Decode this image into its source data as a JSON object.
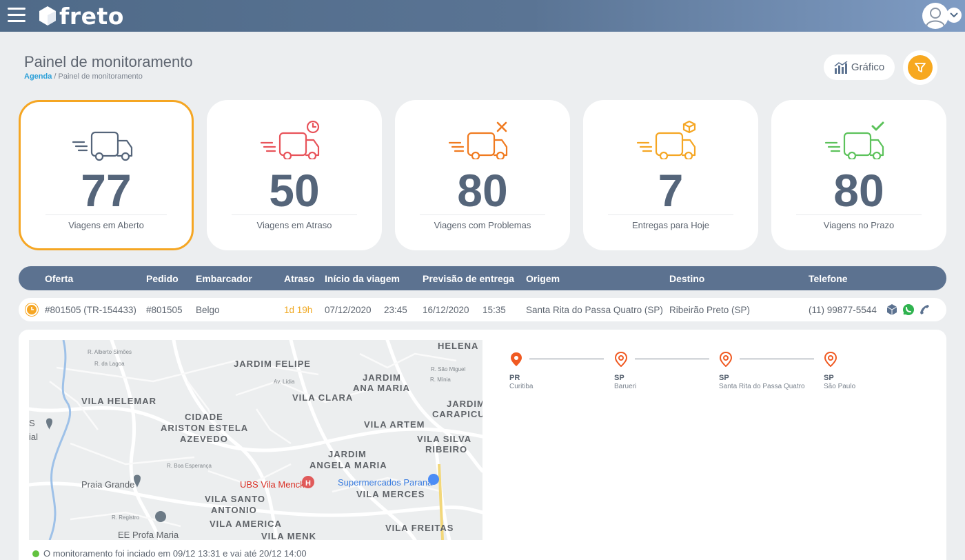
{
  "app": {
    "logo_text": "freto"
  },
  "page": {
    "title": "Painel de monitoramento",
    "breadcrumb_link": "Agenda",
    "breadcrumb_separator": " / ",
    "breadcrumb_current": "Painel de monitoramento"
  },
  "toolbar": {
    "grafico_label": "Gráfico"
  },
  "cards": [
    {
      "value": "77",
      "label": "Viagens em Aberto",
      "color": "#55657a",
      "icon": "truck-icon"
    },
    {
      "value": "50",
      "label": "Viagens em Atraso",
      "color": "#e8535a",
      "icon": "truck-clock-icon"
    },
    {
      "value": "80",
      "label": "Viagens com Problemas",
      "color": "#f07a1f",
      "icon": "truck-tools-icon"
    },
    {
      "value": "7",
      "label": "Entregas para Hoje",
      "color": "#f5a623",
      "icon": "truck-box-icon"
    },
    {
      "value": "80",
      "label": "Viagens no Prazo",
      "color": "#5cc25b",
      "icon": "truck-check-icon"
    }
  ],
  "table": {
    "headers": {
      "oferta": "Oferta",
      "pedido": "Pedido",
      "embarcador": "Embarcador",
      "atraso": "Atraso",
      "inicio": "Início da viagem",
      "previsao": "Previsão de entrega",
      "origem": "Origem",
      "destino": "Destino",
      "telefone": "Telefone"
    },
    "rows": [
      {
        "oferta": "#801505 (TR-154433)",
        "pedido": "#801505",
        "embarcador": "Belgo",
        "atraso": "1d 19h",
        "inicio_data": "07/12/2020",
        "inicio_hora": "23:45",
        "previsao_data": "16/12/2020",
        "previsao_hora": "15:35",
        "origem": "Santa Rita do Passa Quatro (SP)",
        "destino": "Ribeirão Preto (SP)",
        "telefone": "(11) 99877-5544"
      }
    ]
  },
  "map": {
    "labels": {
      "helena": "HELENA",
      "jardim_felipe": "JARDIM FELIPE",
      "jardim_ana_maria_1": "JARDIM",
      "jardim_ana_maria_2": "ANA MARIA",
      "vila_helemar": "VILA HELEMAR",
      "vila_clara": "VILA CLARA",
      "jardim_carapicu_1": "JARDIM",
      "jardim_carapicu_2": "CARAPICU",
      "cidade_1": "CIDADE",
      "cidade_2": "ARISTON ESTELA",
      "cidade_3": "AZEVEDO",
      "vila_artem": "VILA ARTEM",
      "vila_silva_1": "VILA SILVA",
      "vila_silva_2": "RIBEIRO",
      "jardim_angela_1": "JARDIM",
      "jardim_angela_2": "ANGELA MARIA",
      "praia_grande": "Praia Grande",
      "ubs": "UBS Vila Menck",
      "supermercados": "Supermercados Paraná",
      "vila_merces": "VILA MERCES",
      "vila_santo_1": "VILA SANTO",
      "vila_santo_2": "ANTONIO",
      "vila_america": "VILA AMERICA",
      "vila_freitas": "VILA FREITAS",
      "ee_profa": "EE Profa Maria",
      "vila_menk": "VILA MENK",
      "r_alberto": "R. Alberto Simões",
      "r_lagoa": "R. da Lagoa",
      "av_lidia": "Av. Lídia",
      "r_sao_miguel": "R. São Miguel",
      "r_minia": "R. Mínia",
      "r_registro": "R. Registro",
      "r_boa": "R. Boa Esperança",
      "edge_s": "S",
      "edge_ial": "ial"
    }
  },
  "route": {
    "stops": [
      {
        "state": "PR",
        "city": "Curitiba",
        "color": "#f05a22"
      },
      {
        "state": "SP",
        "city": "Barueri",
        "color": "#f05a22"
      },
      {
        "state": "SP",
        "city": "Santa Rita do Passa Quatro",
        "color": "#f05a22"
      },
      {
        "state": "SP",
        "city": "São Paulo",
        "color": "#f05a22"
      }
    ]
  },
  "status": {
    "text": "O monitoramento foi inciado em 09/12 13:31 e vai até 20/12 14:00"
  },
  "colors": {
    "accent": "#f5a623",
    "header": "#5c7290"
  }
}
